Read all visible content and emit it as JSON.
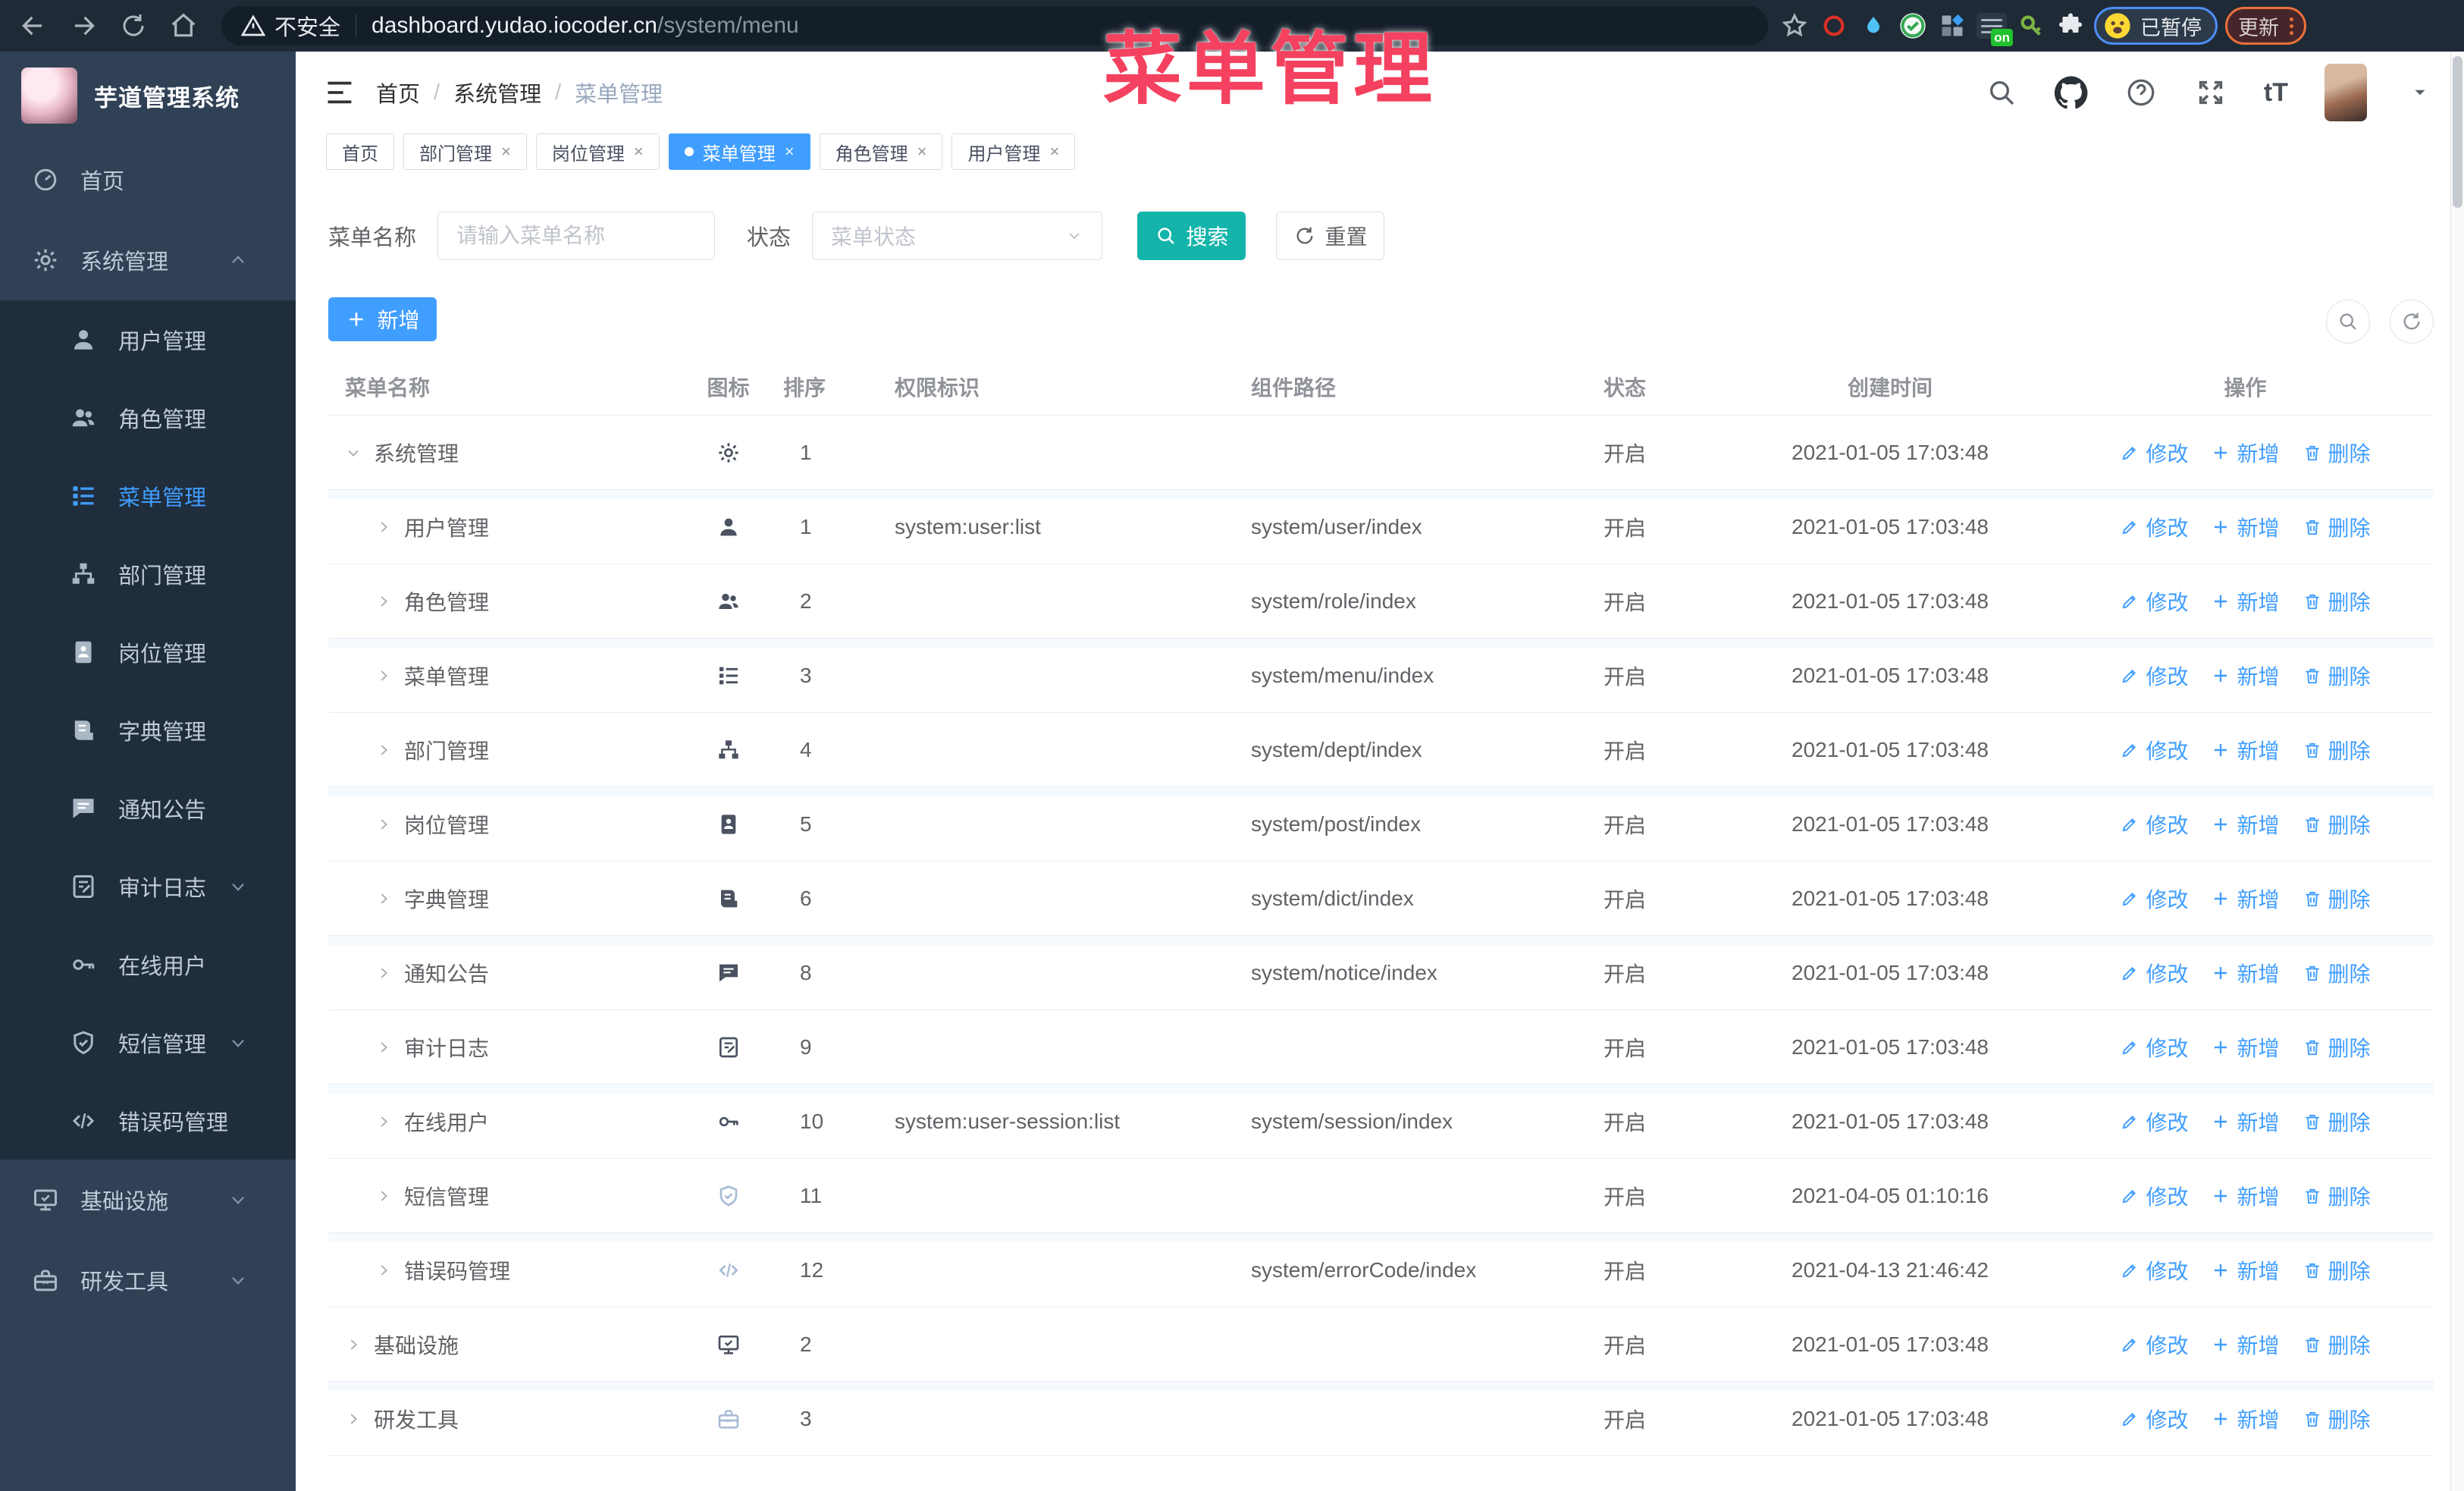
{
  "colors": {
    "accent": "#409eff",
    "search_teal": "#14b4aa",
    "annotation_pink": "#f4415f",
    "sidebar_bg": "#304156",
    "submenu_bg": "#1f2d3d"
  },
  "browser": {
    "security_label": "不安全",
    "url_host": "dashboard.yudao.iocoder.cn",
    "url_path": "/system/menu",
    "extension_badge": "on",
    "profile_label": "已暂停",
    "update_label": "更新"
  },
  "annotation": {
    "text": "菜单管理"
  },
  "sidebar": {
    "logo_title": "芋道管理系统",
    "items": [
      {
        "label": "首页",
        "icon": "dashboard-icon",
        "level": 1
      },
      {
        "label": "系统管理",
        "icon": "gear-icon",
        "level": 1,
        "chevron": "up"
      },
      {
        "label": "用户管理",
        "icon": "user-icon",
        "level": 2
      },
      {
        "label": "角色管理",
        "icon": "users-icon",
        "level": 2
      },
      {
        "label": "菜单管理",
        "icon": "menu-list-icon",
        "level": 2,
        "active": true
      },
      {
        "label": "部门管理",
        "icon": "org-tree-icon",
        "level": 2
      },
      {
        "label": "岗位管理",
        "icon": "badge-icon",
        "level": 2
      },
      {
        "label": "字典管理",
        "icon": "book-icon",
        "level": 2
      },
      {
        "label": "通知公告",
        "icon": "chat-icon",
        "level": 2
      },
      {
        "label": "审计日志",
        "icon": "log-icon",
        "level": 2,
        "chevron": "down"
      },
      {
        "label": "在线用户",
        "icon": "key-icon",
        "level": 2
      },
      {
        "label": "短信管理",
        "icon": "shield-icon",
        "level": 2,
        "chevron": "down"
      },
      {
        "label": "错误码管理",
        "icon": "code-icon",
        "level": 2
      },
      {
        "label": "基础设施",
        "icon": "monitor-icon",
        "level": 1,
        "chevron": "down"
      },
      {
        "label": "研发工具",
        "icon": "toolbox-icon",
        "level": 1,
        "chevron": "down"
      }
    ]
  },
  "header": {
    "breadcrumb": [
      "首页",
      "系统管理",
      "菜单管理"
    ],
    "font_icon_label": "tT"
  },
  "tabs": [
    {
      "label": "首页",
      "active": false,
      "closable": false
    },
    {
      "label": "部门管理",
      "active": false,
      "closable": true
    },
    {
      "label": "岗位管理",
      "active": false,
      "closable": true
    },
    {
      "label": "菜单管理",
      "active": true,
      "closable": true
    },
    {
      "label": "角色管理",
      "active": false,
      "closable": true
    },
    {
      "label": "用户管理",
      "active": false,
      "closable": true
    }
  ],
  "search": {
    "name_label": "菜单名称",
    "name_placeholder": "请输入菜单名称",
    "status_label": "状态",
    "status_placeholder": "菜单状态",
    "search_label": "搜索",
    "reset_label": "重置"
  },
  "toolbar": {
    "add_label": "新增"
  },
  "table": {
    "headers": [
      "菜单名称",
      "图标",
      "排序",
      "权限标识",
      "组件路径",
      "状态",
      "创建时间",
      "操作"
    ],
    "actions": [
      {
        "label": "修改",
        "icon": "edit-icon"
      },
      {
        "label": "新增",
        "icon": "plus-icon"
      },
      {
        "label": "删除",
        "icon": "trash-icon"
      }
    ],
    "rows": [
      {
        "name": "系统管理",
        "level": 1,
        "expanded": true,
        "icon": "gear-icon",
        "sort": "1",
        "perm": "",
        "path": "",
        "status": "开启",
        "time": "2021-01-05 17:03:48"
      },
      {
        "name": "用户管理",
        "level": 2,
        "expanded": false,
        "icon": "user-icon",
        "sort": "1",
        "perm": "system:user:list",
        "path": "system/user/index",
        "status": "开启",
        "time": "2021-01-05 17:03:48"
      },
      {
        "name": "角色管理",
        "level": 2,
        "expanded": false,
        "icon": "users-icon",
        "sort": "2",
        "perm": "",
        "path": "system/role/index",
        "status": "开启",
        "time": "2021-01-05 17:03:48"
      },
      {
        "name": "菜单管理",
        "level": 2,
        "expanded": false,
        "icon": "menu-list-icon",
        "sort": "3",
        "perm": "",
        "path": "system/menu/index",
        "status": "开启",
        "time": "2021-01-05 17:03:48"
      },
      {
        "name": "部门管理",
        "level": 2,
        "expanded": false,
        "icon": "org-tree-icon",
        "sort": "4",
        "perm": "",
        "path": "system/dept/index",
        "status": "开启",
        "time": "2021-01-05 17:03:48"
      },
      {
        "name": "岗位管理",
        "level": 2,
        "expanded": false,
        "icon": "badge-icon",
        "sort": "5",
        "perm": "",
        "path": "system/post/index",
        "status": "开启",
        "time": "2021-01-05 17:03:48"
      },
      {
        "name": "字典管理",
        "level": 2,
        "expanded": false,
        "icon": "book-icon",
        "sort": "6",
        "perm": "",
        "path": "system/dict/index",
        "status": "开启",
        "time": "2021-01-05 17:03:48"
      },
      {
        "name": "通知公告",
        "level": 2,
        "expanded": false,
        "icon": "chat-icon",
        "sort": "8",
        "perm": "",
        "path": "system/notice/index",
        "status": "开启",
        "time": "2021-01-05 17:03:48"
      },
      {
        "name": "审计日志",
        "level": 2,
        "expanded": false,
        "icon": "log-icon",
        "sort": "9",
        "perm": "",
        "path": "",
        "status": "开启",
        "time": "2021-01-05 17:03:48"
      },
      {
        "name": "在线用户",
        "level": 2,
        "expanded": false,
        "icon": "key-icon",
        "sort": "10",
        "perm": "system:user-session:list",
        "path": "system/session/index",
        "status": "开启",
        "time": "2021-01-05 17:03:48"
      },
      {
        "name": "短信管理",
        "level": 2,
        "expanded": false,
        "icon": "shield-icon",
        "sort": "11",
        "perm": "",
        "path": "",
        "status": "开启",
        "time": "2021-04-05 01:10:16",
        "muted": true
      },
      {
        "name": "错误码管理",
        "level": 2,
        "expanded": false,
        "icon": "code-icon",
        "sort": "12",
        "perm": "",
        "path": "system/errorCode/index",
        "status": "开启",
        "time": "2021-04-13 21:46:42",
        "muted": true
      },
      {
        "name": "基础设施",
        "level": 1,
        "expanded": false,
        "icon": "monitor-icon",
        "sort": "2",
        "perm": "",
        "path": "",
        "status": "开启",
        "time": "2021-01-05 17:03:48"
      },
      {
        "name": "研发工具",
        "level": 1,
        "expanded": false,
        "icon": "toolbox-icon",
        "sort": "3",
        "perm": "",
        "path": "",
        "status": "开启",
        "time": "2021-01-05 17:03:48",
        "muted": true
      }
    ]
  }
}
